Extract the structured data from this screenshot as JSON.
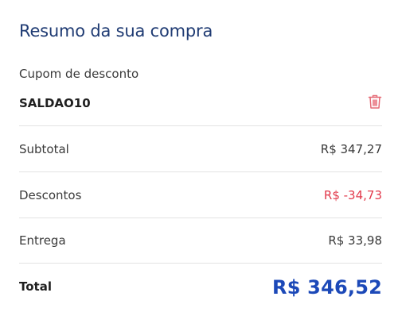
{
  "summary": {
    "title": "Resumo da sua compra",
    "coupon": {
      "label": "Cupom de desconto",
      "code": "SALDAO10",
      "remove_icon": "trash-icon"
    },
    "rows": {
      "subtotal": {
        "label": "Subtotal",
        "value": "R$ 347,27"
      },
      "discount": {
        "label": "Descontos",
        "value": "R$ -34,73"
      },
      "shipping": {
        "label": "Entrega",
        "value": "R$ 33,98"
      }
    },
    "total": {
      "label": "Total",
      "value": "R$ 346,52"
    }
  },
  "colors": {
    "title": "#1f3b73",
    "discount": "#e2394b",
    "total": "#1c49b8",
    "divider": "#e3e3e3"
  }
}
